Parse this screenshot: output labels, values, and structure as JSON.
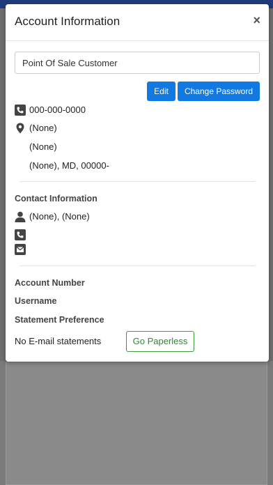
{
  "modal": {
    "title": "Account Information",
    "close_label": "×"
  },
  "account": {
    "name": "Point Of Sale Customer",
    "phone": "000-000-0000",
    "address_line1": "(None)",
    "address_line2": "(None)",
    "address_line3": "(None), MD, 00000-"
  },
  "buttons": {
    "edit": "Edit",
    "change_password": "Change Password",
    "go_paperless": "Go Paperless"
  },
  "contact": {
    "heading": "Contact Information",
    "person": "(None), (None)"
  },
  "details": {
    "account_number_label": "Account Number",
    "username_label": "Username",
    "statement_preference_label": "Statement Preference",
    "statement_value": "No E-mail statements"
  },
  "colors": {
    "primary": "#1279e3",
    "paperless": "#2e8b2e",
    "icon": "#444444"
  }
}
